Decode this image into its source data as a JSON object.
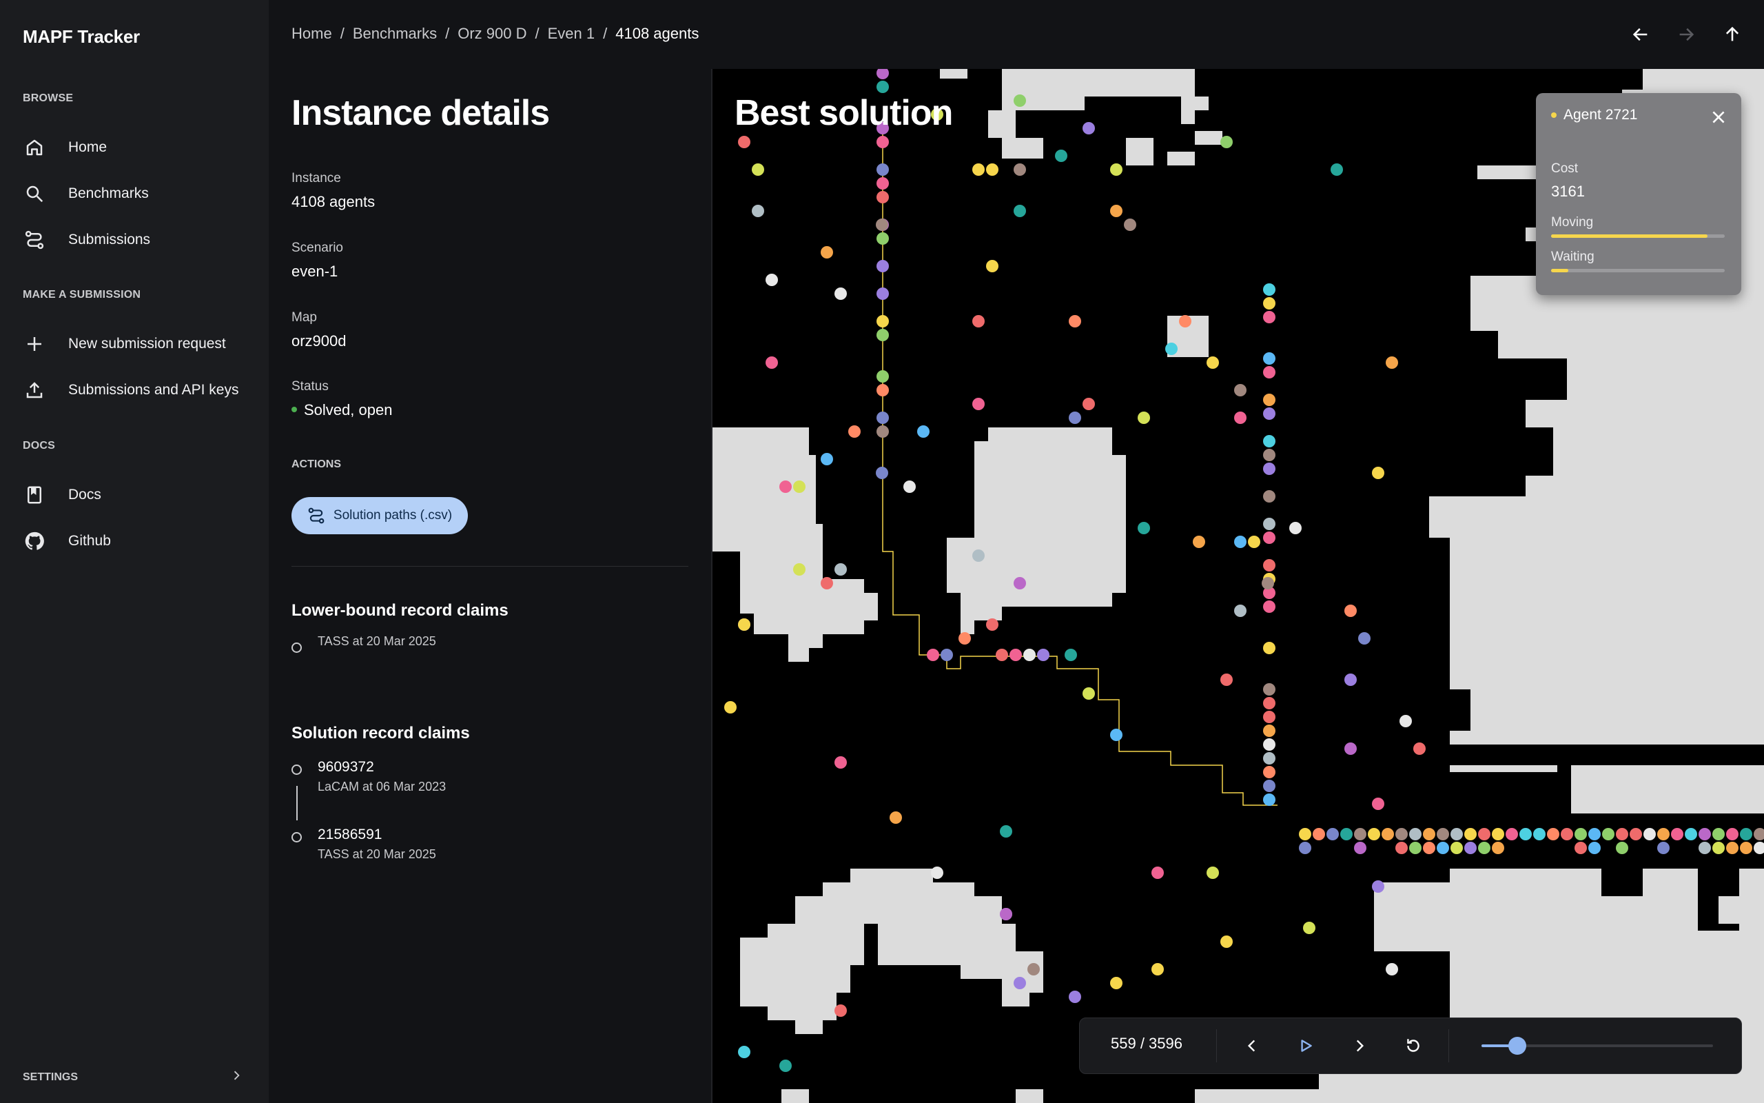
{
  "sidebar": {
    "app_title": "MAPF Tracker",
    "sections": {
      "browse": "BROWSE",
      "make_submission": "MAKE A SUBMISSION",
      "docs": "DOCS"
    },
    "items": [
      {
        "label": "Home",
        "icon": "home-icon"
      },
      {
        "label": "Benchmarks",
        "icon": "search-icon"
      },
      {
        "label": "Submissions",
        "icon": "route-icon"
      },
      {
        "label": "New submission request",
        "icon": "plus-icon"
      },
      {
        "label": "Submissions and API keys",
        "icon": "upload-icon"
      },
      {
        "label": "Docs",
        "icon": "book-icon"
      },
      {
        "label": "Github",
        "icon": "github-icon"
      }
    ],
    "settings_label": "SETTINGS"
  },
  "breadcrumb": [
    "Home",
    "Benchmarks",
    "Orz 900 D",
    "Even 1",
    "4108 agents"
  ],
  "details": {
    "title": "Instance details",
    "instance_label": "Instance",
    "instance_value": "4108 agents",
    "scenario_label": "Scenario",
    "scenario_value": "even-1",
    "map_label": "Map",
    "map_value": "orz900d",
    "status_label": "Status",
    "status_value": "Solved, open",
    "status_color": "#4caf50",
    "actions_label": "ACTIONS",
    "csv_button": "Solution paths (.csv)",
    "lower_bound_title": "Lower-bound record claims",
    "lower_bound_claims": [
      {
        "text": "TASS at 20 Mar 2025"
      }
    ],
    "solution_title": "Solution record claims",
    "solution_claims": [
      {
        "value": "9609372",
        "sub": "LaCAM at 06 Mar 2023"
      },
      {
        "value": "21586591",
        "sub": "TASS at 20 Mar 2025"
      }
    ]
  },
  "map": {
    "title": "Best solution",
    "agent_card": {
      "title": "Agent 2721",
      "cost_label": "Cost",
      "cost_value": "3161",
      "moving_label": "Moving",
      "moving_fraction": 0.9,
      "waiting_label": "Waiting",
      "waiting_fraction": 0.1,
      "accent": "#f6d64c"
    },
    "agent_colors": [
      "#f6d64c",
      "#ef6b6b",
      "#5bb8f5",
      "#9b7fe0",
      "#f5a54a",
      "#8fcf6b",
      "#e8e8e8",
      "#f06292",
      "#4dd0e1",
      "#a1887f",
      "#b0bec5",
      "#d4e157",
      "#26a69a",
      "#7986cb",
      "#ba68c8",
      "#ff8a65"
    ]
  },
  "player": {
    "frame": "559 / 3596",
    "progress": 0.155,
    "accent": "#8db4f0"
  }
}
